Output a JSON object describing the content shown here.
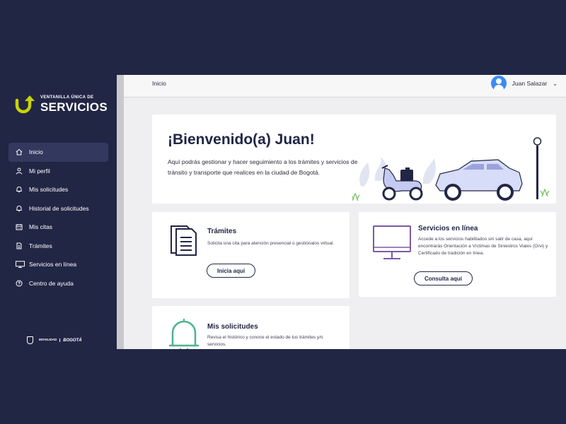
{
  "brand": {
    "small_text": "VENTANILLA ÚNICA DE",
    "big_text": "SERVICIOS"
  },
  "sidebar": {
    "items": [
      {
        "label": "Inicio",
        "icon": "home-icon",
        "active": true
      },
      {
        "label": "Mi perfil",
        "icon": "user-icon"
      },
      {
        "label": "Mis solicitudes",
        "icon": "bell-icon"
      },
      {
        "label": "Historial de solicitudes",
        "icon": "bell-icon"
      },
      {
        "label": "Mis citas",
        "icon": "calendar-icon"
      },
      {
        "label": "Trámites",
        "icon": "document-icon"
      },
      {
        "label": "Servicios en línea",
        "icon": "monitor-icon"
      },
      {
        "label": "Centro de ayuda",
        "icon": "help-icon"
      }
    ]
  },
  "footer": {
    "movilidad": "MOVILIDAD",
    "bogota": "BOGOTÁ"
  },
  "topbar": {
    "breadcrumb": "Inicio",
    "user_name": "Juan Salazar"
  },
  "welcome": {
    "title": "¡Bienvenido(a) Juan!",
    "text": "Aquí podrás gestionar y hacer seguimiento a los trámites y servicios de tránsito y transporte que realices en la ciudad de Bogotá."
  },
  "cards": {
    "tramites": {
      "title": "Trámites",
      "text": "Solicita una cita para atención presencial o gestiónalos virtual.",
      "button": "Inicia aquí"
    },
    "servicios": {
      "title": "Servicios en línea",
      "text": "Accede a los servicios habilitados sin salir de casa, aquí encontrarás Orientación a Víctimas de Siniestros Viales (Orvi) y Certificado de tradición en línea.",
      "button": "Consulta aquí"
    },
    "solicitudes": {
      "title": "Mis solicitudes",
      "text": "Revisa el histórico y conoce el estado de tus trámites y/o servicios."
    }
  },
  "colors": {
    "navy": "#222645",
    "accent_yellow": "#c8d400",
    "avatar_blue": "#3d8af7",
    "purple_icon": "#7b5aa6",
    "green_icon": "#4db38e"
  }
}
